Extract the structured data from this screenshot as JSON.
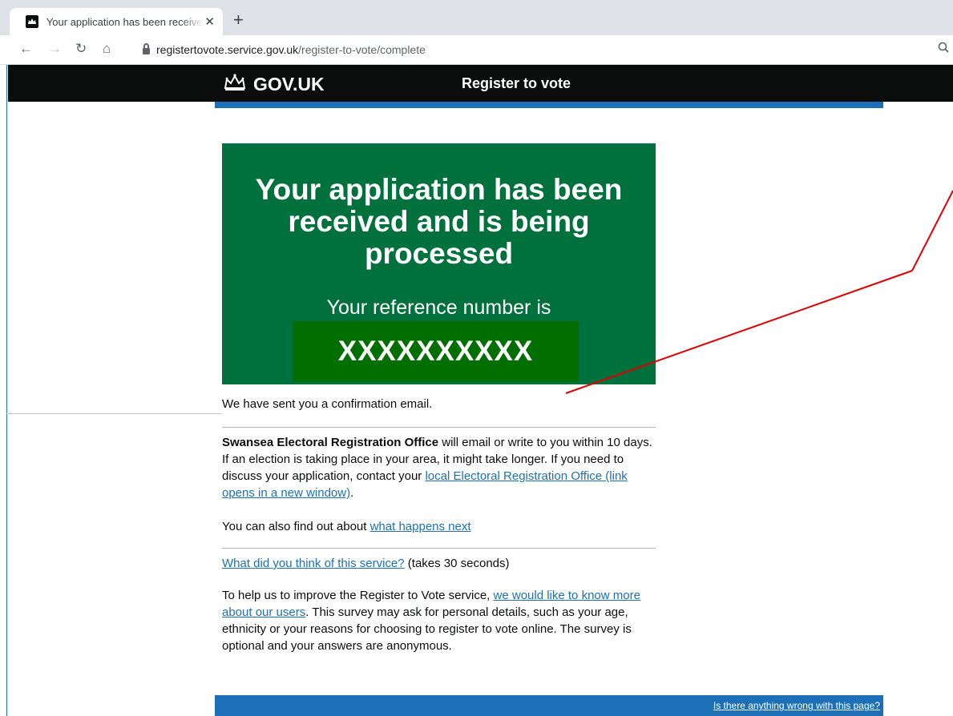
{
  "browser": {
    "tab_title": "Your application has been received and is being processed",
    "url_host": "registertovote.service.gov.uk",
    "url_path": "/register-to-vote/complete"
  },
  "header": {
    "logo_text": "GOV.UK",
    "service_name": "Register to vote"
  },
  "panel": {
    "title": "Your application has been received and is being processed",
    "reference_label": "Your reference number is",
    "reference_number": "XXXXXXXXXX"
  },
  "content": {
    "confirmation": "We have sent you a confirmation email.",
    "office_name": "Swansea Electoral Registration Office",
    "office_text": " will email or write to you within 10 days. If an election is taking place in your area, it might take longer. If you need to discuss your application, contact your ",
    "office_link": "local Electoral Registration Office (link opens in a new window)",
    "office_text_end": ".",
    "next_text": "You can also find out about ",
    "next_link": "what happens next",
    "feedback_link": "What did you think of this service?",
    "feedback_text": " (takes 30 seconds)",
    "survey_text": "To help us to improve the Register to Vote service, ",
    "survey_link": "we would like to know more about our users",
    "survey_text_end": ". This survey may ask for personal details, such as your age, ethnicity or your reasons for choosing to register to vote online. The survey is optional and your answers are anonymous."
  },
  "footer": {
    "report_link": "Is there anything wrong with this page?"
  },
  "colors": {
    "gov_black": "#0b0c0c",
    "gov_blue": "#1d70b8",
    "panel_green": "#00703c",
    "annotation_red": "#e00000"
  }
}
